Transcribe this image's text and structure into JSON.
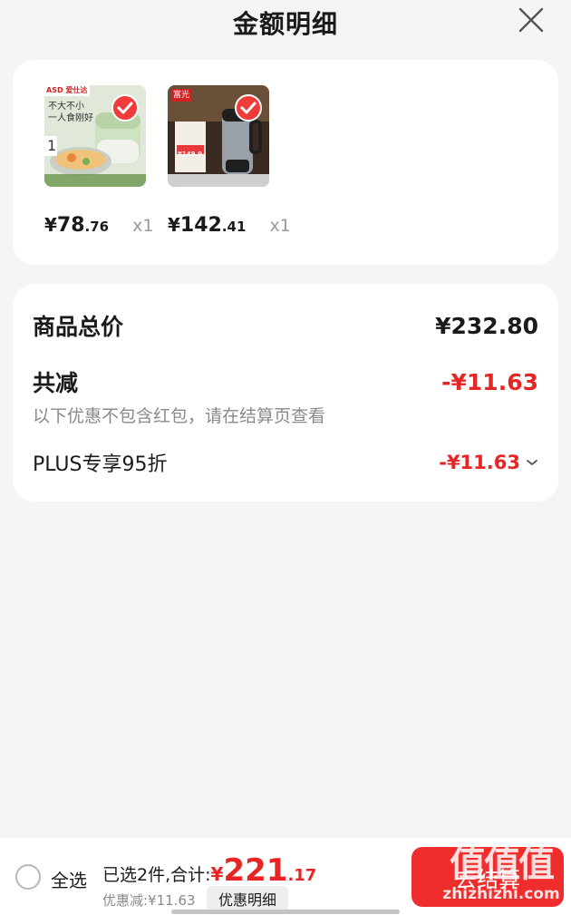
{
  "header": {
    "title": "金额明细"
  },
  "products": [
    {
      "yen": "¥",
      "price_int": "78",
      "price_dec": ".76",
      "qty": "x1",
      "brand_badge": "ASD 爱仕达",
      "thumb_text1": "不大不小",
      "thumb_text2": "一人食刚好"
    },
    {
      "yen": "¥",
      "price_int": "142",
      "price_dec": ".41",
      "qty": "x1",
      "brand_badge": "富光",
      "thumb_text1": "¥149.9"
    }
  ],
  "summary": {
    "total_label": "商品总价",
    "total_value": "¥232.80",
    "reduce_label": "共减",
    "reduce_value": "-¥11.63",
    "note": "以下优惠不包含红包，请在结算页查看",
    "plus_label": "PLUS专享95折",
    "plus_value": "-¥11.63"
  },
  "footer": {
    "select_all": "全选",
    "selected_text": "已选2件,合计:",
    "yen": "¥",
    "total_int": "221",
    "total_dec": ".17",
    "discount_text": "优惠减:¥11.63",
    "detail_button": "优惠明细",
    "checkout_button": "去结算"
  },
  "watermark": {
    "big": "值值值",
    "small": "zhizhizhi.com"
  },
  "colors": {
    "accent_red": "#e82525",
    "check_red": "#f03b3b",
    "background": "#f5f5f5"
  }
}
